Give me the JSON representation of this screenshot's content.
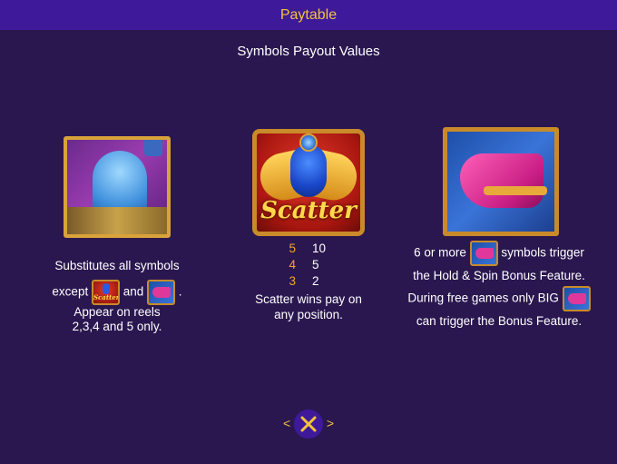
{
  "header": {
    "title": "Paytable"
  },
  "section": {
    "title": "Symbols Payout Values"
  },
  "wild": {
    "icon": "genie-lamp-wild-icon",
    "line1": "Substitutes all symbols",
    "except_word": "except",
    "and_word": "and",
    "period": ".",
    "line3": "Appear on reels",
    "line4": "2,3,4 and 5 only."
  },
  "scatter": {
    "icon": "scatter-scarab-icon",
    "icon_text": "Scatter",
    "mini_text": "Scatter",
    "payouts": [
      {
        "count": "5",
        "value": "10"
      },
      {
        "count": "4",
        "value": "5"
      },
      {
        "count": "3",
        "value": "2"
      }
    ],
    "line1": "Scatter wins pay on",
    "line2": "any position."
  },
  "bonus": {
    "icon": "magic-slipper-bonus-icon",
    "line1_prefix": "6 or more",
    "line1_suffix": "symbols trigger",
    "line2": "the Hold & Spin Bonus Feature.",
    "line3_prefix": "During free games only BIG",
    "line4": "can trigger the Bonus Feature."
  },
  "nav": {
    "prev": "<",
    "next": ">",
    "close_icon": "close-x-icon"
  },
  "colors": {
    "background": "#2a1750",
    "header": "#3e1a9a",
    "title": "#f5c23a",
    "payout_count": "#f5a623"
  }
}
